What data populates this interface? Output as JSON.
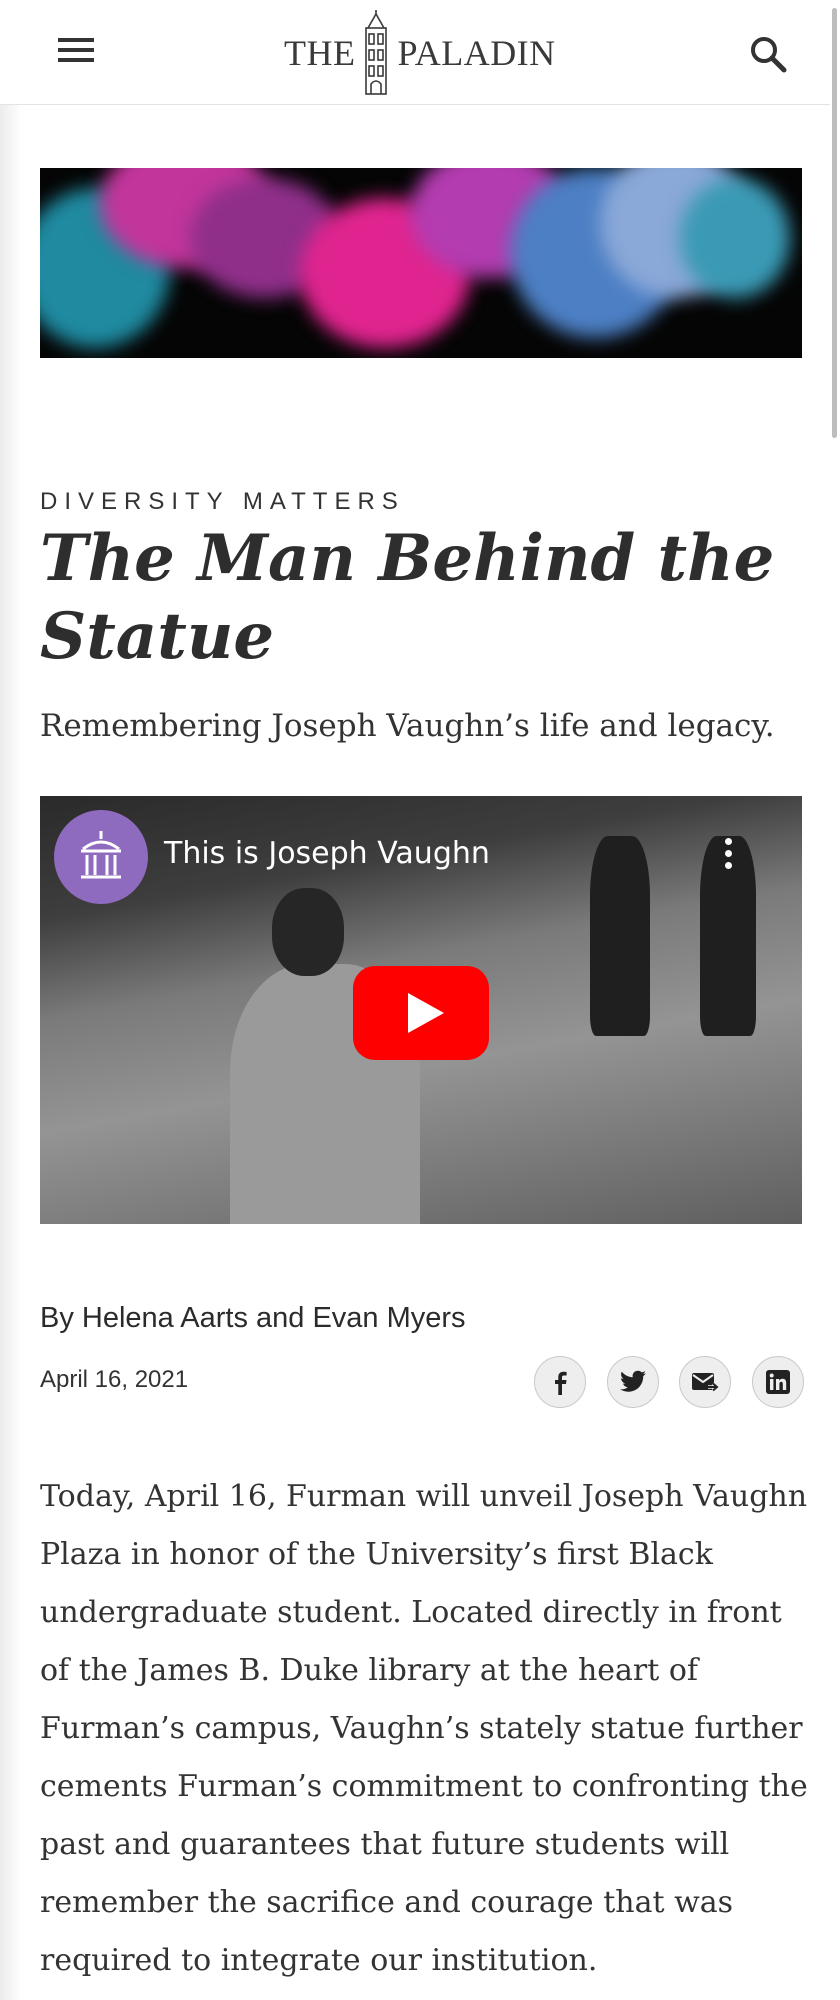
{
  "header": {
    "logo_left": "THE",
    "logo_right": "PALADIN",
    "menu_icon": "hamburger-menu-icon",
    "search_icon": "search-icon"
  },
  "article": {
    "kicker": "DIVERSITY MATTERS",
    "title": "The Man Behind the Statue",
    "subtitle": "Remembering Joseph Vaughn’s life and legacy.",
    "video": {
      "title": "This is Joseph Vaughn",
      "play_icon": "youtube-play-icon",
      "menu_icon": "more-options-icon"
    },
    "byline": "By Helena Aarts and Evan Myers",
    "date": "April 16, 2021",
    "share": {
      "facebook": "facebook-icon",
      "twitter": "twitter-icon",
      "email": "email-icon",
      "linkedin": "linkedin-icon"
    },
    "body": "Today, April 16, Furman will unveil Joseph Vaughn Plaza in honor of the University’s first Black undergraduate student. Located directly in front of the James B. Duke library at the heart of Furman’s campus, Vaughn’s stately statue further cements Furman’s commitment to confronting the past and guarantees that future students will remember the sacrifice and courage that was required to integrate our institution."
  },
  "colors": {
    "text": "#2d2d2d",
    "youtube_red": "#ff0000",
    "channel_purple": "#8e6bbf"
  }
}
